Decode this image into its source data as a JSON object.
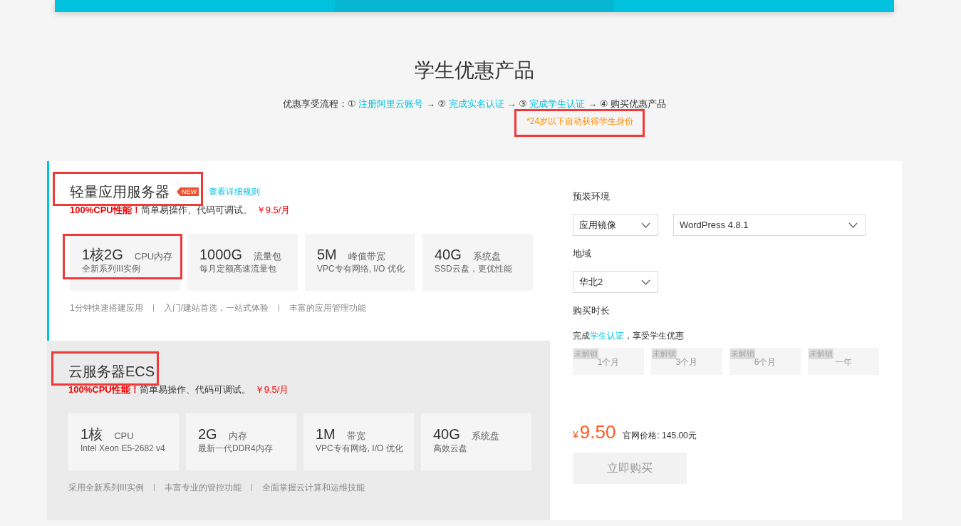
{
  "top_tabs": [
    {
      "selected": false
    },
    {
      "selected": true
    },
    {
      "selected": false
    }
  ],
  "page_title": "学生优惠产品",
  "process": {
    "label": "优惠享受流程：",
    "steps": [
      {
        "number": "①",
        "text": "注册阿里云账号",
        "kind": "link"
      },
      {
        "arrow": "→",
        "number": "②",
        "text": "完成实名认证",
        "kind": "link"
      },
      {
        "arrow": "→",
        "number": "③",
        "text": "完成学生认证",
        "kind": "link"
      },
      {
        "arrow": "→",
        "number": "④",
        "text": "购买优惠产品",
        "kind": "plain"
      }
    ],
    "note": {
      "text": "*24岁以下自动获得学生身份",
      "highlighted": true
    }
  },
  "products": [
    {
      "title": "轻量应用服务器",
      "title_highlighted": true,
      "badge": "NEW",
      "link": "查看详细规则",
      "selected": true,
      "tagline": {
        "highlight": "100%CPU性能！",
        "text": "简单易操作、代码可调试。",
        "price": "￥9.5/月"
      },
      "specs": [
        {
          "value": "1核2G",
          "unit": "CPU内存",
          "detail": "全新系列III实例",
          "highlighted": true
        },
        {
          "value": "1000G",
          "unit": "流量包",
          "detail": "每月定额高速流量包",
          "highlighted": false
        },
        {
          "value": "5M",
          "unit": "峰值带宽",
          "detail": "VPC专有网络, I/O 优化",
          "highlighted": false
        },
        {
          "value": "40G",
          "unit": "系统盘",
          "detail": "SSD云盘，更优性能",
          "highlighted": false
        }
      ],
      "features": [
        "1分钟快速搭建应用",
        "入门/建站首选，一站式体验",
        "丰富的应用管理功能"
      ]
    },
    {
      "title": "云服务器ECS",
      "title_highlighted": true,
      "selected": false,
      "tagline": {
        "highlight": "100%CPU性能！",
        "text": "简单易操作、代码可调试。",
        "price": "￥9.5/月"
      },
      "specs": [
        {
          "value": "1核",
          "unit": "CPU",
          "detail": "Intel Xeon E5-2682 v4",
          "highlighted": false
        },
        {
          "value": "2G",
          "unit": "内存",
          "detail": "最新一代DDR4内存",
          "highlighted": false
        },
        {
          "value": "1M",
          "unit": "带宽",
          "detail": "VPC专有网络, I/O 优化",
          "highlighted": false
        },
        {
          "value": "40G",
          "unit": "系统盘",
          "detail": "高效云盘",
          "highlighted": false
        }
      ],
      "features": [
        "采用全新系列III实例",
        "丰富专业的管控功能",
        "全面掌握云计算和运维技能"
      ]
    }
  ],
  "config": {
    "sections": [
      {
        "label": "预装环境",
        "selects": [
          {
            "value": "应用镜像"
          },
          {
            "value": "WordPress 4.8.1"
          }
        ]
      },
      {
        "label": "地域",
        "selects": [
          {
            "value": "华北2"
          }
        ]
      }
    ],
    "duration": {
      "label": "购买时长",
      "hint": {
        "before": "完成",
        "link": "学生认证",
        "after": "，享受学生优惠"
      },
      "options": [
        {
          "label": "1个月",
          "tag": "未解锁",
          "locked": true,
          "selected": false
        },
        {
          "label": "3个月",
          "tag": "未解锁",
          "locked": true,
          "selected": false
        },
        {
          "label": "6个月",
          "tag": "未解锁",
          "locked": true,
          "selected": false
        },
        {
          "label": "一年",
          "tag": "未解锁",
          "locked": true,
          "selected": false
        }
      ]
    },
    "price": {
      "currency": "¥",
      "amount": "9.50",
      "list_price": "官网价格: 145.00元"
    },
    "buy_button": {
      "label": "立即购买",
      "disabled": true
    }
  }
}
